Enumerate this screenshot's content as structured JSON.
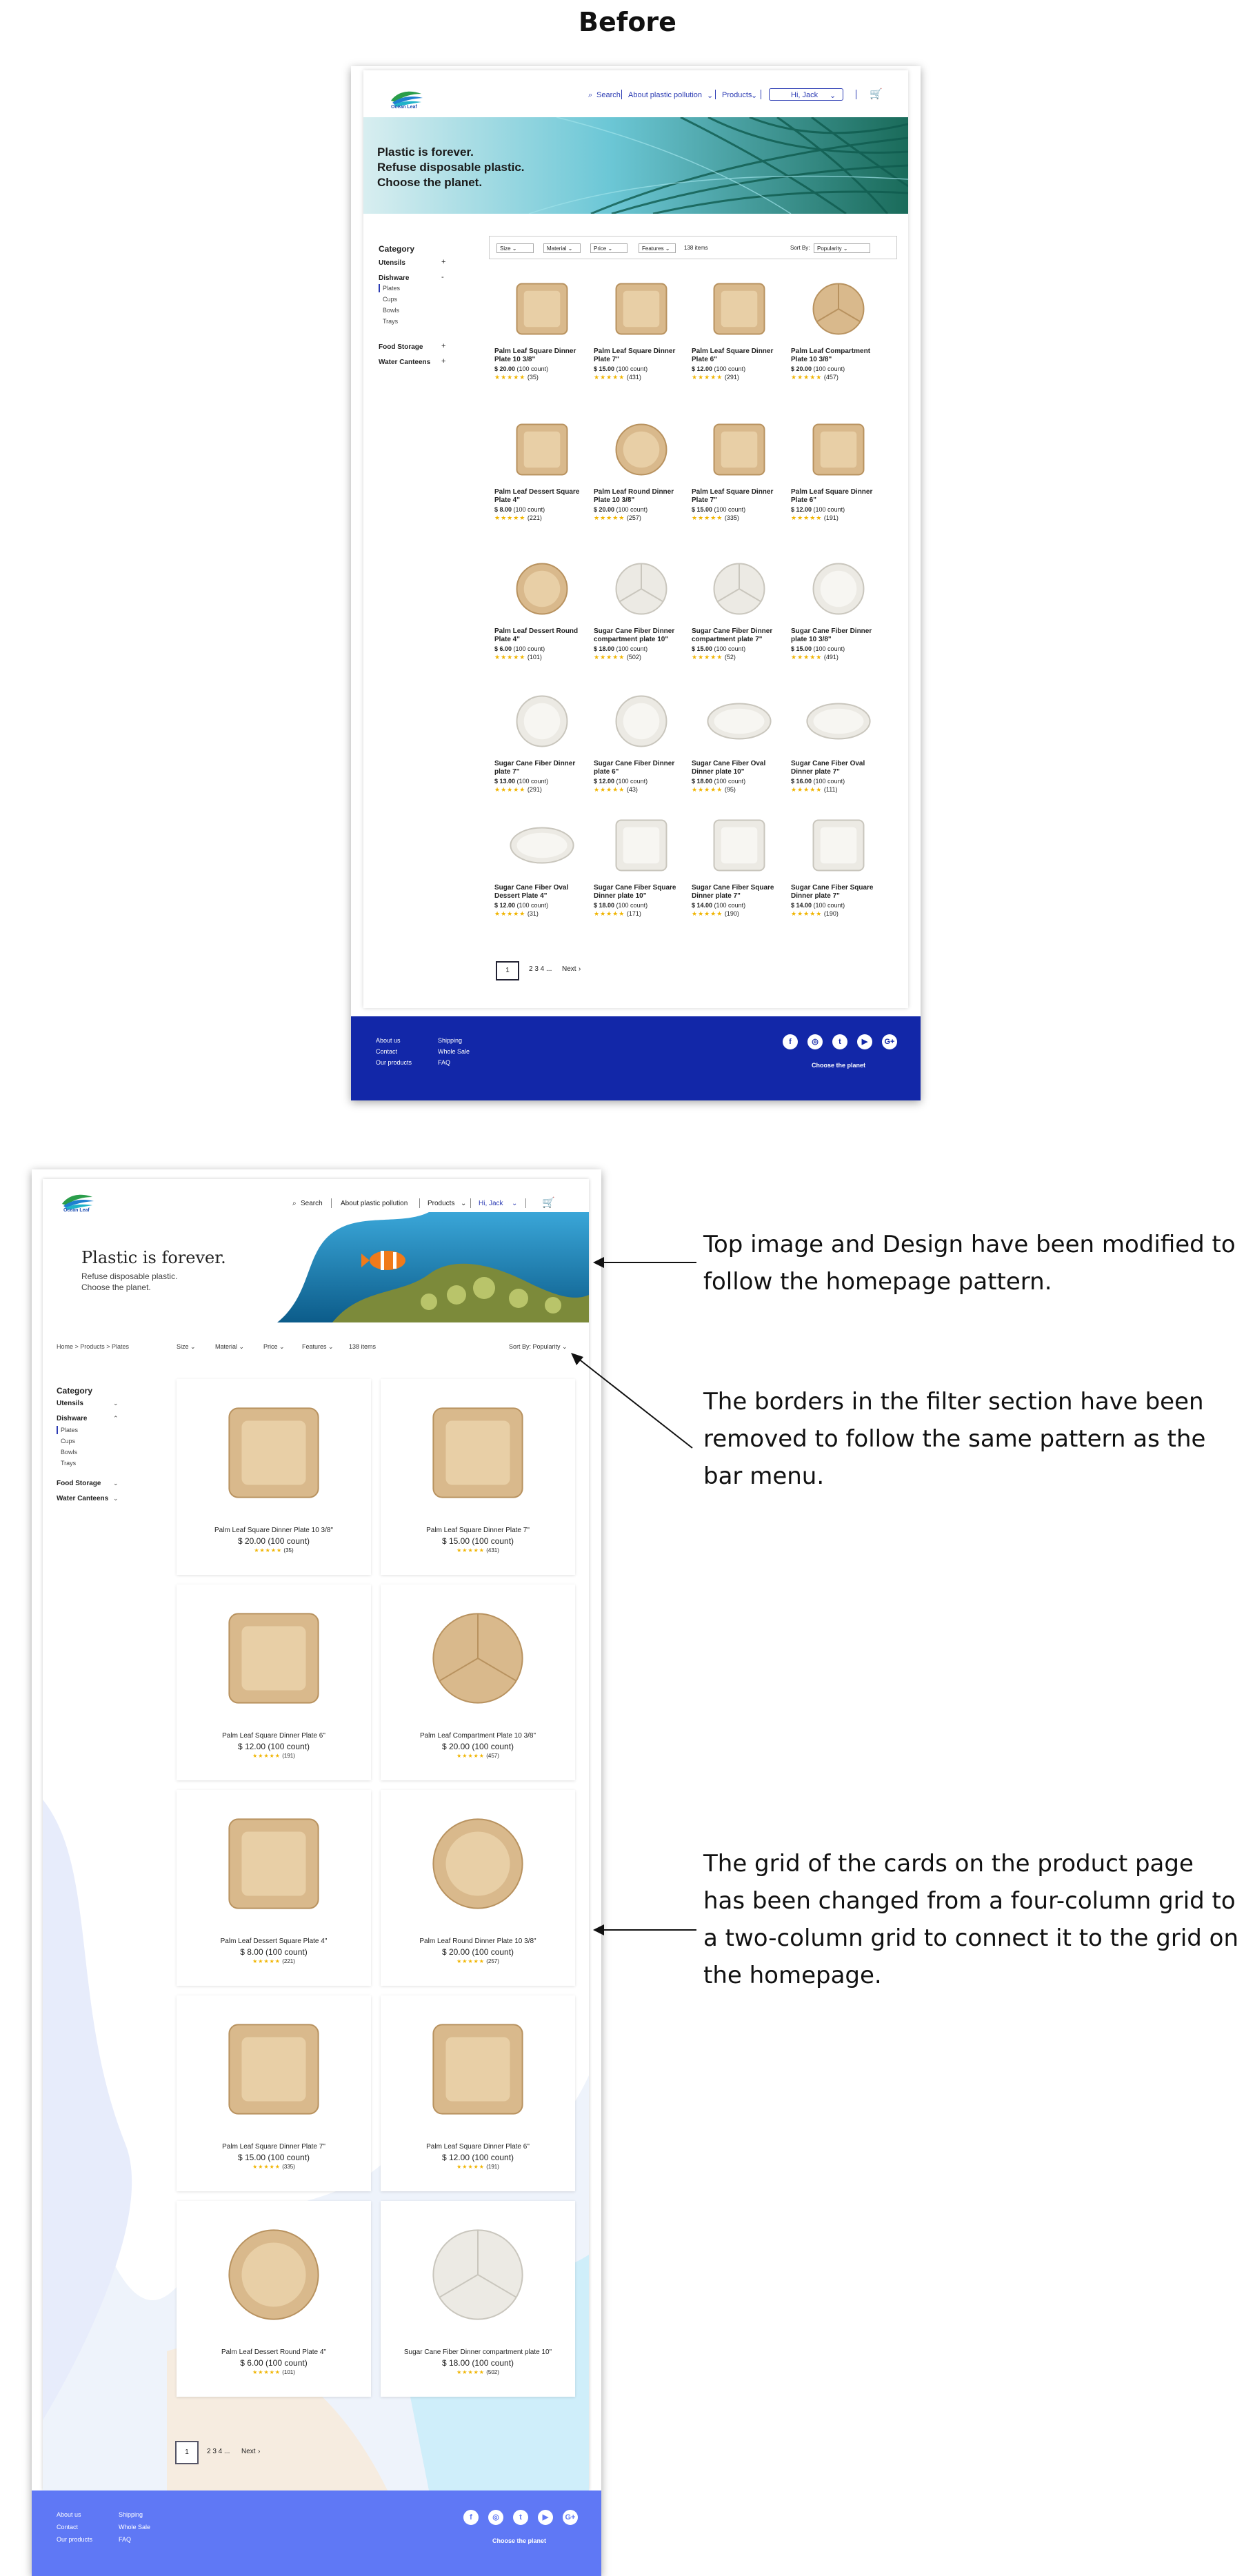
{
  "heading": "Before",
  "header": {
    "logo_text": "Ocean Leaf",
    "search_label": "Search",
    "about_label": "About plastic pollution",
    "products_label": "Products",
    "user_label": "Hi, Jack"
  },
  "before": {
    "hero_lines": [
      "Plastic is forever.",
      "Refuse disposable plastic.",
      "Choose the planet."
    ],
    "category_title": "Category",
    "sidebar": [
      {
        "label": "Utensils",
        "sign": "+"
      },
      {
        "label": "Dishware",
        "sign": "-"
      },
      {
        "label": "Plates"
      },
      {
        "label": "Cups"
      },
      {
        "label": "Bowls"
      },
      {
        "label": "Trays"
      },
      {
        "label": "Food Storage",
        "sign": "+"
      },
      {
        "label": "Water Canteens",
        "sign": "+"
      }
    ],
    "filters": {
      "size": "Size",
      "material": "Material",
      "price": "Price",
      "features": "Features",
      "count": "138 items",
      "sort_label": "Sort By:",
      "sort_value": "Popularity"
    },
    "products": [
      {
        "name": "Palm Leaf Square Dinner Plate 10 3/8\"",
        "price": "$ 20.00",
        "count": "(100 count)",
        "reviews": "(35)",
        "stars": "★★★★★"
      },
      {
        "name": "Palm Leaf Square Dinner Plate 7\"",
        "price": "$ 15.00",
        "count": "(100 count)",
        "reviews": "(431)",
        "stars": "★★★★★"
      },
      {
        "name": "Palm Leaf Square Dinner Plate 6\"",
        "price": "$ 12.00",
        "count": "(100 count)",
        "reviews": "(291)",
        "stars": "★★★★★"
      },
      {
        "name": "Palm Leaf Compartment Plate 10 3/8\"",
        "price": "$ 20.00",
        "count": "(100 count)",
        "reviews": "(457)",
        "stars": "★★★★★"
      },
      {
        "name": "Palm Leaf Dessert Square Plate 4\"",
        "price": "$ 8.00",
        "count": "(100 count)",
        "reviews": "(221)",
        "stars": "★★★★★"
      },
      {
        "name": "Palm Leaf Round Dinner Plate 10 3/8\"",
        "price": "$ 20.00",
        "count": "(100 count)",
        "reviews": "(257)",
        "stars": "★★★★★"
      },
      {
        "name": "Palm Leaf Square Dinner Plate 7\"",
        "price": "$ 15.00",
        "count": "(100 count)",
        "reviews": "(335)",
        "stars": "★★★★★"
      },
      {
        "name": "Palm Leaf Square Dinner Plate 6\"",
        "price": "$ 12.00",
        "count": "(100 count)",
        "reviews": "(191)",
        "stars": "★★★★★"
      },
      {
        "name": "Palm Leaf Dessert Round Plate 4\"",
        "price": "$ 6.00",
        "count": "(100 count)",
        "reviews": "(101)",
        "stars": "★★★★★"
      },
      {
        "name": "Sugar Cane Fiber Dinner compartment plate 10\"",
        "price": "$ 18.00",
        "count": "(100 count)",
        "reviews": "(502)",
        "stars": "★★★★★"
      },
      {
        "name": "Sugar Cane Fiber Dinner compartment plate 7\"",
        "price": "$ 15.00",
        "count": "(100 count)",
        "reviews": "(52)",
        "stars": "★★★★★"
      },
      {
        "name": "Sugar Cane Fiber Dinner plate 10 3/8\"",
        "price": "$ 15.00",
        "count": "(100 count)",
        "reviews": "(491)",
        "stars": "★★★★★"
      },
      {
        "name": "Sugar Cane Fiber Dinner plate 7\"",
        "price": "$ 13.00",
        "count": "(100 count)",
        "reviews": "(291)",
        "stars": "★★★★★"
      },
      {
        "name": "Sugar Cane Fiber Dinner plate 6\"",
        "price": "$ 12.00",
        "count": "(100 count)",
        "reviews": "(43)",
        "stars": "★★★★★"
      },
      {
        "name": "Sugar Cane Fiber Oval Dinner plate 10\"",
        "price": "$ 18.00",
        "count": "(100 count)",
        "reviews": "(95)",
        "stars": "★★★★★"
      },
      {
        "name": "Sugar Cane Fiber Oval Dinner plate 7\"",
        "price": "$ 16.00",
        "count": "(100 count)",
        "reviews": "(111)",
        "stars": "★★★★★"
      },
      {
        "name": "Sugar Cane Fiber Oval Dessert Plate 4\"",
        "price": "$ 12.00",
        "count": "(100 count)",
        "reviews": "(31)",
        "stars": "★★★★★"
      },
      {
        "name": "Sugar Cane Fiber Square Dinner plate 10\"",
        "price": "$ 18.00",
        "count": "(100 count)",
        "reviews": "(171)",
        "stars": "★★★★★"
      },
      {
        "name": "Sugar Cane Fiber Square Dinner plate 7\"",
        "price": "$ 14.00",
        "count": "(100 count)",
        "reviews": "(190)",
        "stars": "★★★★★"
      },
      {
        "name": "Sugar Cane Fiber Square Dinner plate 7\"",
        "price": "$ 14.00",
        "count": "(100 count)",
        "reviews": "(190)",
        "stars": "★★★★★"
      }
    ],
    "pagination": {
      "current": "1",
      "pages": "2  3  4  ...",
      "next": "Next"
    }
  },
  "after": {
    "hero_title": "Plastic is forever.",
    "hero_sub": [
      "Refuse disposable plastic.",
      "Choose the planet."
    ],
    "breadcrumb": "Home > Products > Plates",
    "filters": {
      "size": "Size",
      "material": "Material",
      "price": "Price",
      "features": "Features",
      "count": "138 items",
      "sort": "Sort By:  Popularity"
    },
    "category_title": "Category",
    "sidebar": [
      {
        "label": "Utensils"
      },
      {
        "label": "Dishware"
      },
      {
        "label": "Plates"
      },
      {
        "label": "Cups"
      },
      {
        "label": "Bowls"
      },
      {
        "label": "Trays"
      },
      {
        "label": "Food Storage"
      },
      {
        "label": "Water Canteens"
      }
    ],
    "products": [
      {
        "name": "Palm Leaf Square Dinner Plate 10 3/8\"",
        "price": "$ 20.00",
        "count": "(100 count)",
        "reviews": "(35)",
        "stars": "★★★★★"
      },
      {
        "name": "Palm Leaf Square Dinner Plate 7\"",
        "price": "$ 15.00",
        "count": "(100 count)",
        "reviews": "(431)",
        "stars": "★★★★★"
      },
      {
        "name": "Palm Leaf Square Dinner Plate 6\"",
        "price": "$ 12.00",
        "count": "(100 count)",
        "reviews": "(191)",
        "stars": "★★★★★"
      },
      {
        "name": "Palm Leaf Compartment Plate 10 3/8\"",
        "price": "$ 20.00",
        "count": "(100 count)",
        "reviews": "(457)",
        "stars": "★★★★★"
      },
      {
        "name": "Palm Leaf Dessert Square Plate 4\"",
        "price": "$ 8.00",
        "count": "(100 count)",
        "reviews": "(221)",
        "stars": "★★★★★"
      },
      {
        "name": "Palm Leaf Round Dinner Plate 10 3/8\"",
        "price": "$ 20.00",
        "count": "(100 count)",
        "reviews": "(257)",
        "stars": "★★★★★"
      },
      {
        "name": "Palm Leaf Square Dinner Plate 7\"",
        "price": "$ 15.00",
        "count": "(100 count)",
        "reviews": "(335)",
        "stars": "★★★★★"
      },
      {
        "name": "Palm Leaf Square Dinner Plate 6\"",
        "price": "$ 12.00",
        "count": "(100 count)",
        "reviews": "(191)",
        "stars": "★★★★★"
      },
      {
        "name": "Palm Leaf Dessert Round Plate 4\"",
        "price": "$ 6.00",
        "count": "(100 count)",
        "reviews": "(101)",
        "stars": "★★★★★"
      },
      {
        "name": "Sugar Cane Fiber Dinner compartment plate 10\"",
        "price": "$ 18.00",
        "count": "(100 count)",
        "reviews": "(502)",
        "stars": "★★★★★"
      }
    ],
    "pagination": {
      "current": "1",
      "pages": "2  3  4  ...",
      "next": "Next"
    }
  },
  "footer": {
    "col1": [
      "About us",
      "Contact",
      "Our products"
    ],
    "col2": [
      "Shipping",
      "Whole Sale",
      "FAQ"
    ],
    "tagline": "Choose the planet",
    "social": [
      "f",
      "◎",
      "t",
      "▶",
      "G+"
    ]
  },
  "annotations": [
    "Top image and Design have been modified to follow the homepage pattern.",
    "The borders in the filter section have been removed to follow the same pattern as the bar menu.",
    "The grid of the cards on the product page has been changed from a four-column grid to a two-column grid to connect it to the grid on the homepage."
  ],
  "colors": {
    "before_footer": "#1227a8",
    "after_footer": "#5f78f5",
    "nav_blue": "#2b3bb3",
    "star": "#f0b400"
  }
}
